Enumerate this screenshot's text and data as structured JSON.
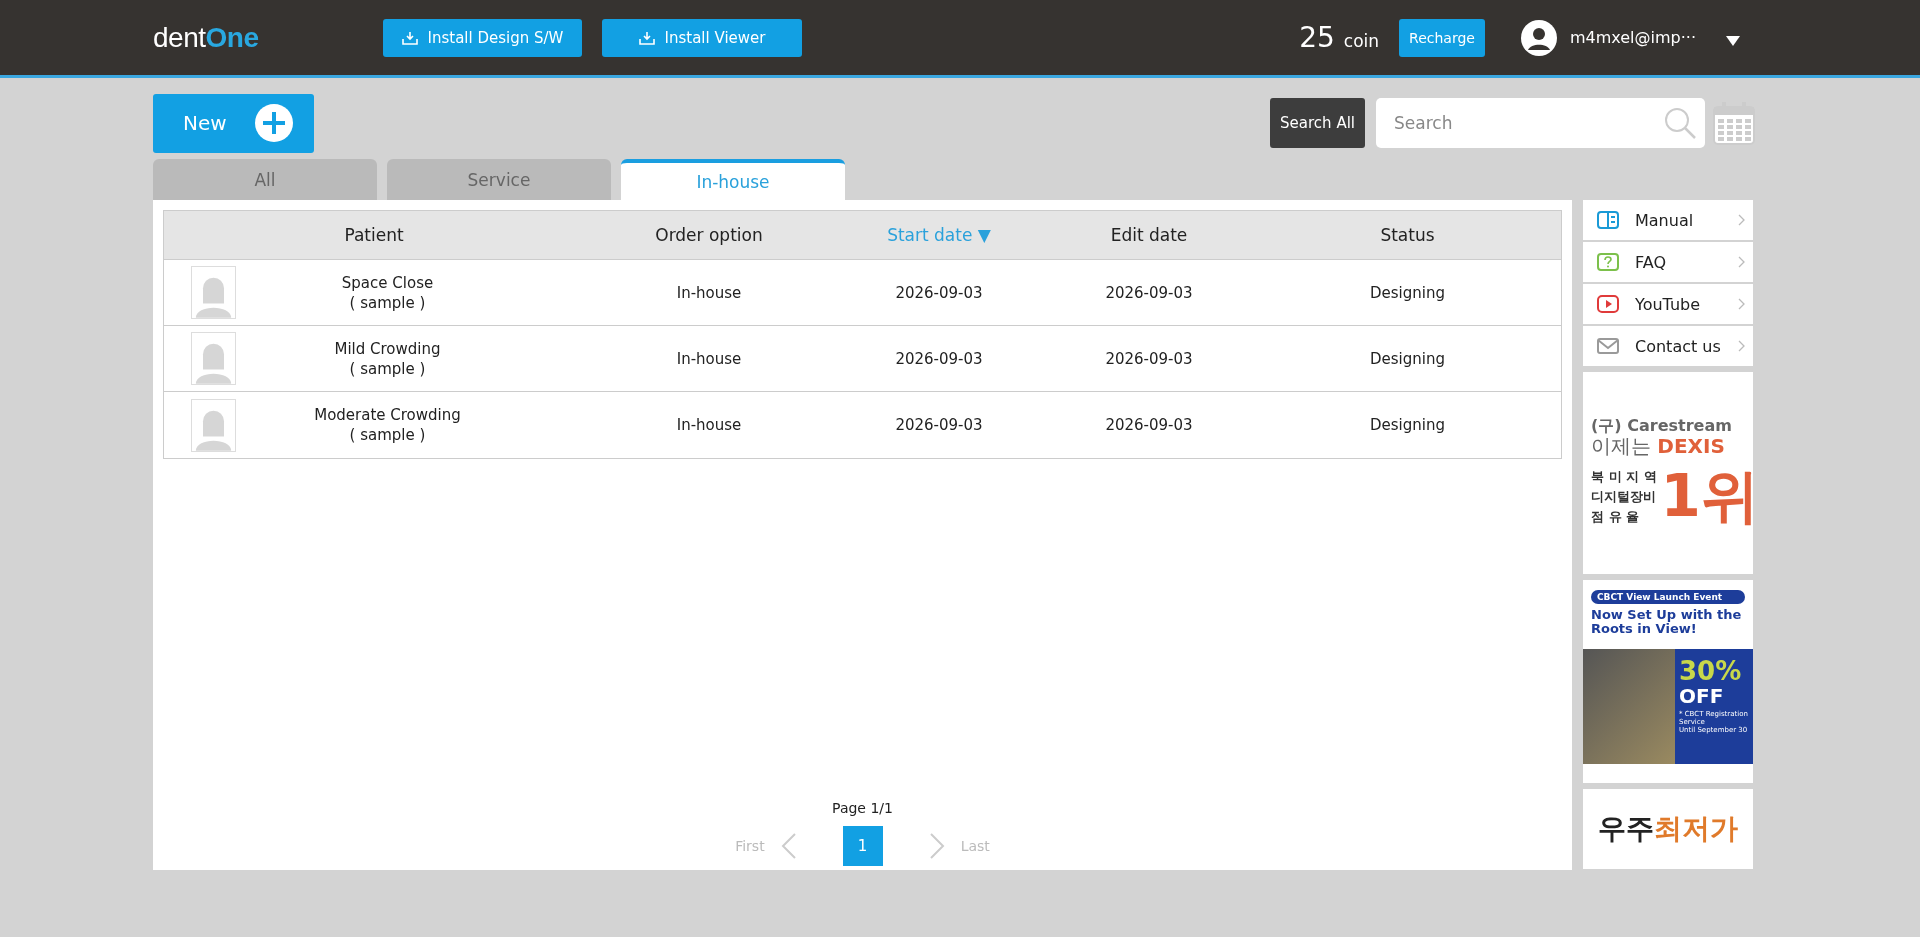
{
  "header": {
    "logo": {
      "part_1": "dent",
      "part_2": "One"
    },
    "install_buttons": [
      "Install Design S/W",
      "Install Viewer"
    ],
    "coin": {
      "amount": "25",
      "unit": "coin"
    },
    "recharge": "Recharge",
    "user": "m4mxel@imp···"
  },
  "toolbar": {
    "new_button": "New",
    "search_all": "Search All",
    "search": {
      "placeholder": "Search"
    }
  },
  "tabs": [
    {
      "label": "All",
      "selected": false
    },
    {
      "label": "Service",
      "selected": false
    },
    {
      "label": "In-house",
      "selected": true
    }
  ],
  "table": {
    "columns": [
      {
        "label": "Patient",
        "sorted": false
      },
      {
        "label": "Order option",
        "sorted": false
      },
      {
        "label": "Start date",
        "sorted": true,
        "arrow": "▼"
      },
      {
        "label": "Edit date",
        "sorted": false
      },
      {
        "label": "Status",
        "sorted": false
      }
    ],
    "rows": [
      {
        "name": "Space Close",
        "note": "( sample )",
        "option": "In-house",
        "start": "2026-09-03",
        "edit": "2026-09-03",
        "status": "Designing"
      },
      {
        "name": "Mild Crowding",
        "note": "( sample )",
        "option": "In-house",
        "start": "2026-09-03",
        "edit": "2026-09-03",
        "status": "Designing"
      },
      {
        "name": "Moderate Crowding",
        "note": "( sample )",
        "option": "In-house",
        "start": "2026-09-03",
        "edit": "2026-09-03",
        "status": "Designing"
      }
    ]
  },
  "pagination": {
    "label": "Page 1/1",
    "first": "First",
    "last": "Last",
    "pages": [
      {
        "label": "1",
        "selected": true
      }
    ]
  },
  "sidebar": {
    "links": [
      {
        "kind": "manual",
        "label": "Manual",
        "color": "#1a9ad6"
      },
      {
        "kind": "faq",
        "label": "FAQ",
        "color": "#7cc04b"
      },
      {
        "kind": "youtube",
        "label": "YouTube",
        "color": "#e03a3a"
      },
      {
        "kind": "mail",
        "label": "Contact us",
        "color": "#9a9a9a"
      }
    ],
    "ads": [
      {
        "kind": "dexis",
        "prefix": "(구)",
        "brand": "Carestream",
        "line_1": "이제는",
        "line_1_bold": "DEXIS",
        "lines": [
          "북 미 지 역",
          "디지털장비",
          "점  유  율"
        ],
        "big": "1위"
      },
      {
        "kind": "cbct",
        "tag": "CBCT View Launch Event",
        "headline": "Now Set Up with the Roots in View!",
        "discount": "30%",
        "off": "OFF",
        "fine_1": "* CBCT Registration Service",
        "fine_2": "Until September 30"
      },
      {
        "kind": "price",
        "part_1": "우주",
        "part_2": "최저가"
      }
    ]
  }
}
